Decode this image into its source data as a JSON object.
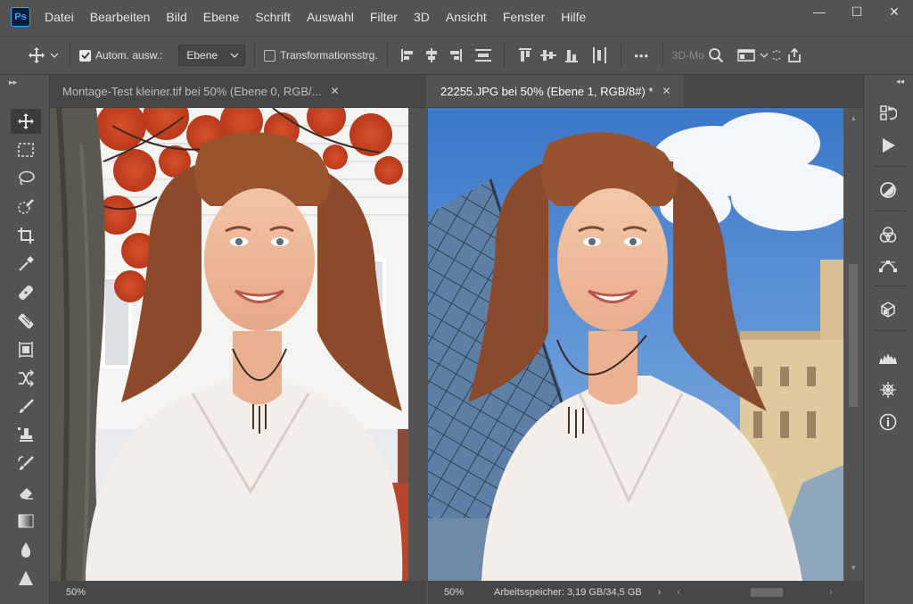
{
  "app": {
    "logo": "Ps"
  },
  "menu": [
    "Datei",
    "Bearbeiten",
    "Bild",
    "Ebene",
    "Schrift",
    "Auswahl",
    "Filter",
    "3D",
    "Ansicht",
    "Fenster",
    "Hilfe"
  ],
  "window_controls": {
    "minimize": "—",
    "maximize": "☐",
    "close": "✕"
  },
  "options": {
    "auto_select_label": "Autom. ausw.:",
    "auto_select_checked": true,
    "auto_select_target": "Ebene",
    "transform_label": "Transformationsstrg.",
    "transform_checked": false,
    "more_label": "•••",
    "mode_3d": "3D-Mo"
  },
  "documents": [
    {
      "tab_label": "Montage-Test kleiner.tif bei 50% (Ebene 0, RGB/...",
      "active": false,
      "zoom": "50%",
      "close": "✕"
    },
    {
      "tab_label": "22255.JPG bei 50% (Ebene 1, RGB/8#) *",
      "active": true,
      "zoom": "50%",
      "scratch": "Arbeitsspeicher: 3,19 GB/34,5 GB",
      "close": "✕"
    }
  ],
  "icons": {
    "left_tools": [
      "move-tool",
      "marquee-tool",
      "lasso-tool",
      "quick-selection-tool",
      "crop-tool",
      "eyedropper-tool",
      "healing-tool",
      "patch-tool",
      "content-aware-move-tool",
      "transform-tool",
      "brush-tool",
      "clone-stamp-tool",
      "history-brush-tool",
      "eraser-tool",
      "gradient-tool",
      "blur-tool",
      "sharpen-tool"
    ],
    "right_panels": [
      "history-panel",
      "actions-panel",
      "adjustments-panel",
      "color-panel",
      "paths-panel",
      "3d-panel",
      "histogram-panel",
      "navigator-panel",
      "info-panel"
    ]
  },
  "colors": {
    "ui_bg": "#535353",
    "panel_dark": "#474747",
    "accent": "#31a8ff"
  }
}
